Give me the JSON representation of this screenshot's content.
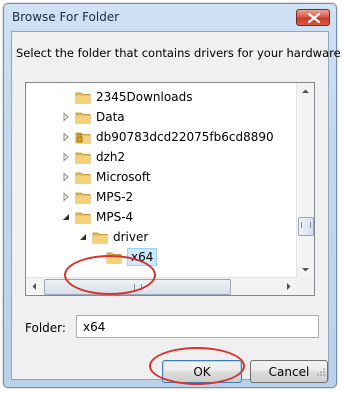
{
  "window": {
    "title": "Browse For Folder"
  },
  "dialog": {
    "instruction": "Select the folder that contains drivers for your hardware."
  },
  "tree": {
    "items": [
      {
        "label": "2345Downloads",
        "level": 2,
        "expander": "none",
        "icon": "folder-icon"
      },
      {
        "label": "Data",
        "level": 2,
        "expander": "collapsed",
        "icon": "folder-icon"
      },
      {
        "label": "db90783dcd22075fb6cd8890",
        "level": 2,
        "expander": "collapsed",
        "icon": "locked-folder-icon"
      },
      {
        "label": "dzh2",
        "level": 2,
        "expander": "collapsed",
        "icon": "folder-icon"
      },
      {
        "label": "Microsoft",
        "level": 2,
        "expander": "collapsed",
        "icon": "folder-icon"
      },
      {
        "label": "MPS-2",
        "level": 2,
        "expander": "collapsed",
        "icon": "folder-icon"
      },
      {
        "label": "MPS-4",
        "level": 2,
        "expander": "expanded",
        "icon": "folder-icon"
      },
      {
        "label": "driver",
        "level": 3,
        "expander": "expanded",
        "icon": "folder-icon"
      },
      {
        "label": "x64",
        "level": 4,
        "expander": "none",
        "icon": "folder-icon",
        "selected": true
      }
    ]
  },
  "folder_field": {
    "label": "Folder:",
    "value": "x64"
  },
  "buttons": {
    "ok": "OK",
    "cancel": "Cancel"
  },
  "colors": {
    "annotation": "#d8322c",
    "selection": "#cde8ff",
    "close_button": "#c83a28"
  }
}
